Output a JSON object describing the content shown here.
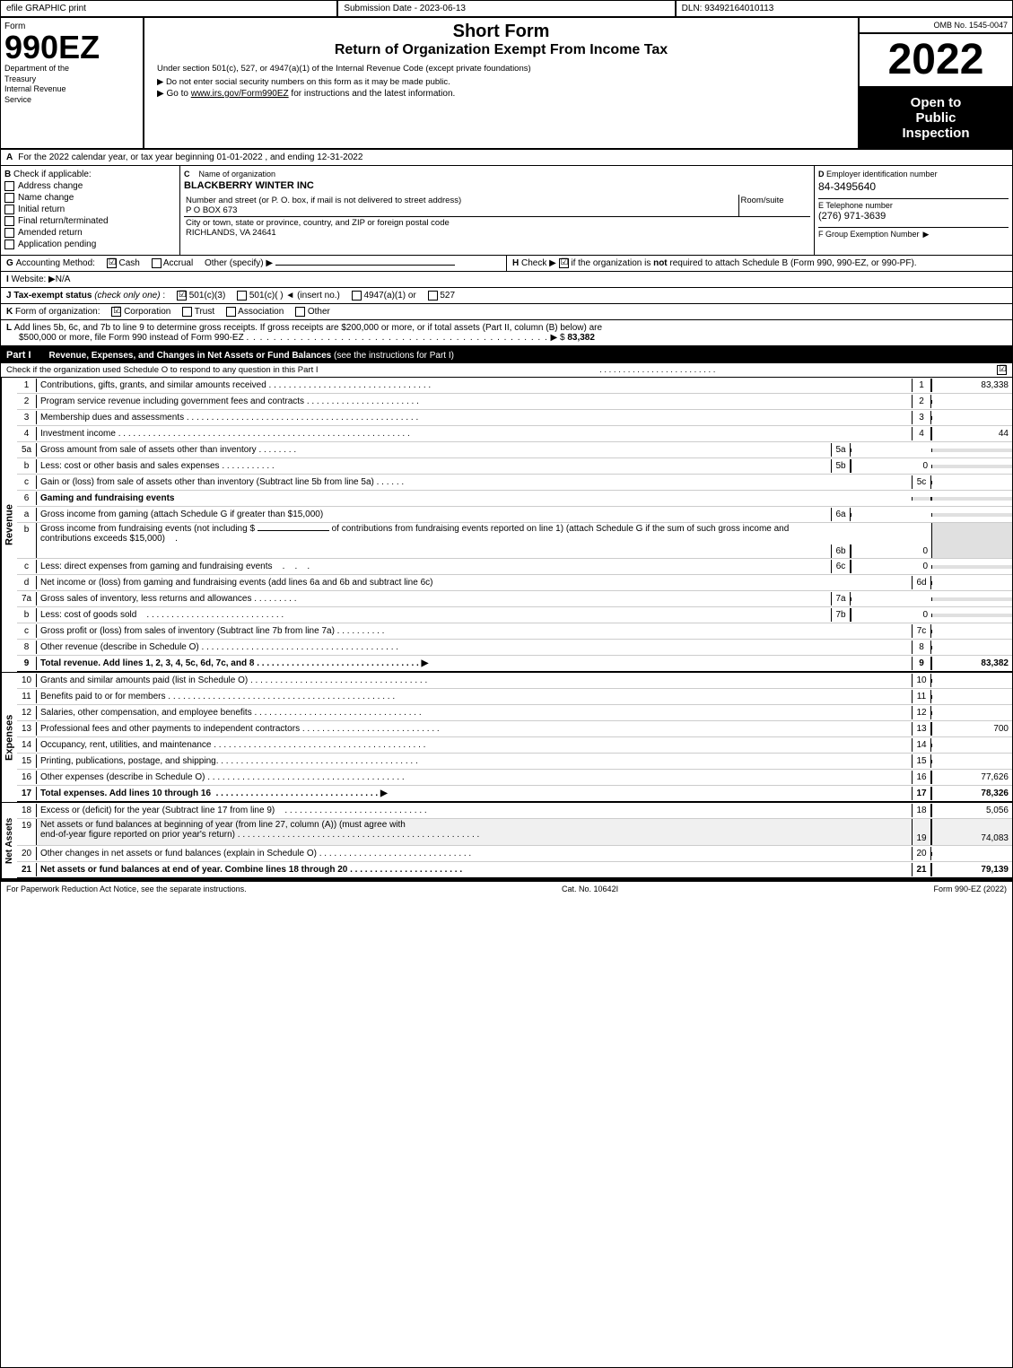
{
  "header": {
    "efile_label": "efile GRAPHIC print",
    "submission_date_label": "Submission Date - 2023-06-13",
    "dln_label": "DLN: 93492164010113",
    "form_number": "990EZ",
    "form_dept1": "Department of the",
    "form_dept2": "Treasury",
    "form_dept3": "Internal Revenue",
    "form_dept4": "Service",
    "short_form": "Short Form",
    "return_title": "Return of Organization Exempt From Income Tax",
    "under_section": "Under section 501(c), 527, or 4947(a)(1) of the Internal Revenue Code (except private foundations)",
    "instruction1": "▶ Do not enter social security numbers on this form as it may be made public.",
    "instruction2": "▶ Go to www.irs.gov/Form990EZ for instructions and the latest information.",
    "omb": "OMB No. 1545-0047",
    "year": "2022",
    "open_to": "Open to",
    "public": "Public",
    "inspection": "Inspection"
  },
  "section_a": {
    "label": "A",
    "text": "For the 2022 calendar year, or tax year beginning 01-01-2022 , and ending 12-31-2022"
  },
  "section_b": {
    "label": "B",
    "sublabel": "Check if applicable:",
    "checkboxes": [
      {
        "id": "address_change",
        "label": "Address change",
        "checked": false
      },
      {
        "id": "name_change",
        "label": "Name change",
        "checked": false
      },
      {
        "id": "initial_return",
        "label": "Initial return",
        "checked": false
      },
      {
        "id": "final_return",
        "label": "Final return/terminated",
        "checked": false
      },
      {
        "id": "amended_return",
        "label": "Amended return",
        "checked": false
      },
      {
        "id": "app_pending",
        "label": "Application pending",
        "checked": false
      }
    ]
  },
  "section_c": {
    "label": "C",
    "sublabel": "Name of organization",
    "org_name": "BLACKBERRY WINTER INC",
    "address_label": "Number and street (or P. O. box, if mail is not delivered to street address)",
    "address": "P O BOX 673",
    "room_suite_label": "Room/suite",
    "room_suite": "",
    "city_label": "City or town, state or province, country, and ZIP or foreign postal code",
    "city": "RICHLANDS, VA  24641"
  },
  "section_d": {
    "label": "D",
    "sublabel": "Employer identification number",
    "ein": "84-3495640",
    "phone_label": "E Telephone number",
    "phone": "(276) 971-3639",
    "group_label": "F Group Exemption Number",
    "group_symbol": "▶"
  },
  "section_g": {
    "label": "G",
    "text": "Accounting Method:",
    "cash_check": true,
    "accrual_check": false,
    "other_label": "Other (specify) ▶"
  },
  "section_h": {
    "label": "H",
    "text": "Check ▶",
    "checkbox": true,
    "description": "if the organization is not required to attach Schedule B (Form 990, 990-EZ, or 990-PF)."
  },
  "section_i": {
    "label": "I",
    "text": "Website: ▶N/A"
  },
  "section_j": {
    "label": "J",
    "text": "Tax-exempt status",
    "note": "(check only one)",
    "options": [
      "501(c)(3)",
      "501(c)(  ) ◄ (insert no.)",
      "4947(a)(1) or",
      "527"
    ],
    "checked": "501(c)(3)"
  },
  "section_k": {
    "label": "K",
    "text": "Form of organization:",
    "options": [
      "Corporation",
      "Trust",
      "Association",
      "Other"
    ],
    "checked": "Corporation"
  },
  "section_l": {
    "label": "L",
    "text1": "Add lines 5b, 6c, and 7b to line 9 to determine gross receipts. If gross receipts are $200,000 or more, or if total assets (Part II, column (B) below) are",
    "text2": "$500,000 or more, file Form 990 instead of Form 990-EZ",
    "dots": ". . . . . . . . . . . . . . . . . . . . . . . . . . . . . . . . . . . . . . . . . . . .",
    "arrow": "▶ $",
    "value": "83,382"
  },
  "part1": {
    "label": "Part I",
    "title": "Revenue, Expenses, and Changes in Net Assets or Fund Balances",
    "see_instructions": "(see the instructions for Part I)",
    "schedule_check": "Check if the organization used Schedule O to respond to any question in this Part I",
    "dots": ". . . . . . . . . . . . . . . . . . . . . . . . .",
    "rows": [
      {
        "num": "1",
        "label": "Contributions, gifts, grants, and similar amounts received",
        "dots": ". . . . . . . . . . . . . . . . . . . . . . . . . . . . . . . . .",
        "line_num": "1",
        "value": "83,338",
        "shaded": false
      },
      {
        "num": "2",
        "label": "Program service revenue including government fees and contracts",
        "dots": ". . . . . . . . . . . . . . . . . . . . . . .",
        "line_num": "2",
        "value": "",
        "shaded": false
      },
      {
        "num": "3",
        "label": "Membership dues and assessments",
        "dots": ". . . . . . . . . . . . . . . . . . . . . . . . . . . . . . . . . . . . . . . . . . . . . . .",
        "line_num": "3",
        "value": "",
        "shaded": false
      },
      {
        "num": "4",
        "label": "Investment income",
        "dots": ". . . . . . . . . . . . . . . . . . . . . . . . . . . . . . . . . . . . . . . . . . . . . . . . . . . . . . . . . . . . .",
        "line_num": "4",
        "value": "44",
        "shaded": false
      },
      {
        "num": "5a",
        "label": "Gross amount from sale of assets other than inventory",
        "dots": ". . . . . . . .",
        "sub_num": "5a",
        "sub_value": "",
        "shaded": false
      },
      {
        "num": "5b",
        "label": "Less: cost or other basis and sales expenses",
        "dots": ". . . . . . . . . . .",
        "sub_num": "5b",
        "sub_value": "0",
        "shaded": false
      },
      {
        "num": "5c",
        "label": "Gain or (loss) from sale of assets other than inventory (Subtract line 5b from line 5a)",
        "dots": ". . . . . .",
        "line_num": "5c",
        "value": "",
        "shaded": false
      },
      {
        "num": "6",
        "label": "Gaming and fundraising events",
        "shaded": false
      },
      {
        "num": "6a",
        "label": "Gross income from gaming (attach Schedule G if greater than $15,000)",
        "sub_num": "6a",
        "sub_value": "",
        "shaded": false
      },
      {
        "num": "6b",
        "label": "Gross income from fundraising events (not including $_____ of contributions from fundraising events reported on line 1) (attach Schedule G if the sum of such gross income and contributions exceeds $15,000)",
        "sub_num": "6b",
        "sub_value": "0",
        "shaded": false
      },
      {
        "num": "6c",
        "label": "Less: direct expenses from gaming and fundraising events",
        "dots": "   .   .   .",
        "sub_num": "6c",
        "sub_value": "0",
        "shaded": false
      },
      {
        "num": "6d",
        "label": "Net income or (loss) from gaming and fundraising events (add lines 6a and 6b and subtract line 6c)",
        "line_num": "6d",
        "value": "",
        "shaded": false
      },
      {
        "num": "7a",
        "label": "Gross sales of inventory, less returns and allowances",
        "dots": ". . . . . . . . .",
        "sub_num": "7a",
        "sub_value": "",
        "shaded": false
      },
      {
        "num": "7b",
        "label": "Less: cost of goods sold",
        "dots": ". . . . . . . . . . . . . . . . . . . . . . . . . . . . .",
        "sub_num": "7b",
        "sub_value": "0",
        "shaded": false
      },
      {
        "num": "7c",
        "label": "Gross profit or (loss) from sales of inventory (Subtract line 7b from line 7a)",
        "dots": ". . . . . . . . . .",
        "line_num": "7c",
        "value": "",
        "shaded": false
      },
      {
        "num": "8",
        "label": "Other revenue (describe in Schedule O)",
        "dots": ". . . . . . . . . . . . . . . . . . . . . . . . . . . . . . . . . . . . . . . .",
        "line_num": "8",
        "value": "",
        "shaded": false
      },
      {
        "num": "9",
        "label": "Total revenue. Add lines 1, 2, 3, 4, 5c, 6d, 7c, and 8",
        "dots": ". . . . . . . . . . . . . . . . . . . . . . . . . . . . . . . . .",
        "arrow": "▶",
        "line_num": "9",
        "value": "83,382",
        "bold": true,
        "shaded": false
      }
    ]
  },
  "expenses": {
    "rows": [
      {
        "num": "10",
        "label": "Grants and similar amounts paid (list in Schedule O)",
        "dots": ". . . . . . . . . . . . . . . . . . . . . . . . . . . . . . . . . . . .",
        "line_num": "10",
        "value": ""
      },
      {
        "num": "11",
        "label": "Benefits paid to or for members",
        "dots": ". . . . . . . . . . . . . . . . . . . . . . . . . . . . . . . . . . . . . . . . . . . . . .",
        "line_num": "11",
        "value": ""
      },
      {
        "num": "12",
        "label": "Salaries, other compensation, and employee benefits",
        "dots": ". . . . . . . . . . . . . . . . . . . . . . . . . . . . . . . . . .",
        "line_num": "12",
        "value": ""
      },
      {
        "num": "13",
        "label": "Professional fees and other payments to independent contractors",
        "dots": ". . . . . . . . . . . . . . . . . . . . . . . . . . . .",
        "line_num": "13",
        "value": "700"
      },
      {
        "num": "14",
        "label": "Occupancy, rent, utilities, and maintenance",
        "dots": ". . . . . . . . . . . . . . . . . . . . . . . . . . . . . . . . . . . . . . . . . . .",
        "line_num": "14",
        "value": ""
      },
      {
        "num": "15",
        "label": "Printing, publications, postage, and shipping",
        "dots": ". . . . . . . . . . . . . . . . . . . . . . . . . . . . . . . . . . . . . . . .",
        "line_num": "15",
        "value": ""
      },
      {
        "num": "16",
        "label": "Other expenses (describe in Schedule O)",
        "dots": ". . . . . . . . . . . . . . . . . . . . . . . . . . . . . . . . . . . . . . . .",
        "line_num": "16",
        "value": "77,626"
      },
      {
        "num": "17",
        "label": "Total expenses. Add lines 10 through 16",
        "dots": "   .   .   .   .   .   .   .   .   .   .   .   .   .   .   .   .   .   .   .   .   .   .   .   .   .   .   .   .   .",
        "arrow": "▶",
        "line_num": "17",
        "value": "78,326",
        "bold": true
      }
    ]
  },
  "net_assets": {
    "rows": [
      {
        "num": "18",
        "label": "Excess or (deficit) for the year (Subtract line 17 from line 9)",
        "dots": ". . . . . . . . . . . . . . . . . . . . . . . . . . . . .",
        "line_num": "18",
        "value": "5,056"
      },
      {
        "num": "19",
        "label": "Net assets or fund balances at beginning of year (from line 27, column (A)) (must agree with end-of-year figure reported on prior year's return)",
        "dots": ". . . . . . . . . . . . . . . . . . . . . . . . . . . . . . . . . . . . . . . . . . . . . . . . .",
        "line_num": "19",
        "value": "74,083",
        "shaded": true
      },
      {
        "num": "20",
        "label": "Other changes in net assets or fund balances (explain in Schedule O)",
        "dots": ". . . . . . . . . . . . . . . . . . . . . . . . . . . . . . .",
        "line_num": "20",
        "value": ""
      },
      {
        "num": "21",
        "label": "Net assets or fund balances at end of year. Combine lines 18 through 20",
        "dots": ". . . . . . . . . . . . . . . . . . . . . . . .",
        "line_num": "21",
        "value": "79,139",
        "bold": true
      }
    ]
  },
  "footer": {
    "paperwork_notice": "For Paperwork Reduction Act Notice, see the separate instructions.",
    "cat_no": "Cat. No. 10642I",
    "form_ref": "Form 990-EZ (2022)"
  }
}
